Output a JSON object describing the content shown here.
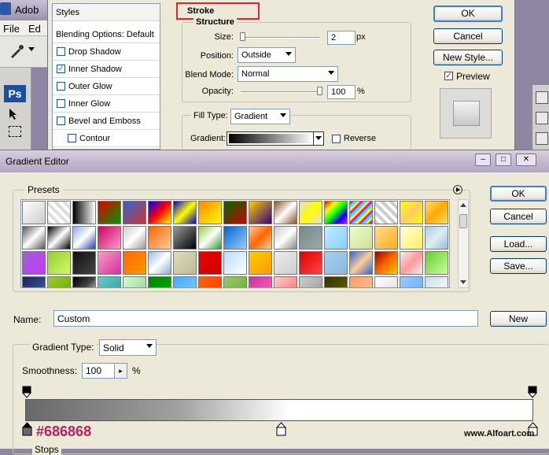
{
  "photoshop": {
    "title": "Adob",
    "menu": [
      "File",
      "Ed"
    ],
    "badge": "Ps"
  },
  "layer_style": {
    "styles_list": {
      "header": "Styles",
      "items": [
        {
          "label": "Blending Options: Default",
          "checkbox": false
        },
        {
          "label": "Drop Shadow",
          "checkbox": true,
          "checked": false
        },
        {
          "label": "Inner Shadow",
          "checkbox": true,
          "checked": true
        },
        {
          "label": "Outer Glow",
          "checkbox": true,
          "checked": false
        },
        {
          "label": "Inner Glow",
          "checkbox": true,
          "checked": false
        },
        {
          "label": "Bevel and Emboss",
          "checkbox": true,
          "checked": false
        },
        {
          "label": "Contour",
          "checkbox": true,
          "checked": false
        }
      ]
    },
    "stroke": {
      "title": "Stroke",
      "structure_label": "Structure",
      "size_label": "Size:",
      "size_value": "2",
      "size_unit": "px",
      "position_label": "Position:",
      "position_value": "Outside",
      "blend_mode_label": "Blend Mode:",
      "blend_mode_value": "Normal",
      "opacity_label": "Opacity:",
      "opacity_value": "100",
      "opacity_unit": "%",
      "fill_type_label": "Fill Type:",
      "fill_type_value": "Gradient",
      "gradient_label": "Gradient:",
      "reverse_label": "Reverse",
      "size_fraction": 0.02,
      "opacity_fraction": 1.0
    },
    "buttons": {
      "ok": "OK",
      "cancel": "Cancel",
      "new_style": "New Style...",
      "preview": "Preview"
    }
  },
  "gradient_editor": {
    "title": "Gradient Editor",
    "presets_label": "Presets",
    "name_label": "Name:",
    "name_value": "Custom",
    "new_button": "New",
    "ok_button": "OK",
    "cancel_button": "Cancel",
    "load_button": "Load...",
    "save_button": "Save...",
    "gradient_type_label": "Gradient Type:",
    "gradient_type_value": "Solid",
    "smoothness_label": "Smoothness:",
    "smoothness_value": "100",
    "smoothness_unit": "%",
    "stops_label": "Stops",
    "selected_stop_color": "#686868",
    "selected_stop_label": "#686868",
    "watermark": "www.Alfoart.com",
    "preset_swatches": [
      "linear-gradient(135deg,#fff,#ccc)",
      "repeating-linear-gradient(45deg,#ddd 0 4px,#fff 4px 8px)",
      "linear-gradient(90deg,#000,#fff)",
      "linear-gradient(135deg,#d00,#090)",
      "linear-gradient(135deg,#36c,#c33)",
      "linear-gradient(135deg,#00f,#f00,#ff0)",
      "linear-gradient(135deg,#00c,#ff0,#00c)",
      "linear-gradient(135deg,#f80,#ff0)",
      "linear-gradient(135deg,#060,#c00)",
      "linear-gradient(135deg,#fc0,#308)",
      "linear-gradient(135deg,#852,#fff,#852)",
      "linear-gradient(135deg,#ddd,#ff0,#ddd)",
      "linear-gradient(135deg,#f00,#ff0,#0f0,#00f,#f0f)",
      "repeating-linear-gradient(135deg,#f0f 0 3px,#0ff 3px 6px,#ff0 6px 9px)",
      "repeating-linear-gradient(45deg,#ccc 0 4px,#fff 4px 8px)",
      "linear-gradient(135deg,#ff0,#fc6,#ff0)",
      "linear-gradient(135deg,#fd6,#fa0,#fd6)",
      "linear-gradient(135deg,#555,#fff,#555)",
      "linear-gradient(135deg,#000,#fff,#000)",
      "linear-gradient(135deg,#8ae,#fff,#24a)",
      "linear-gradient(135deg,#c06,#f9c)",
      "linear-gradient(135deg,#ccc,#fff,#999)",
      "linear-gradient(135deg,#f60,#fc9)",
      "linear-gradient(135deg,#999,#000)",
      "linear-gradient(135deg,#9c3,#fff,#393)",
      "linear-gradient(135deg,#06c,#9cf)",
      "linear-gradient(135deg,#fc9,#f60,#fc9)",
      "linear-gradient(135deg,#ccc,#fff,#888)",
      "linear-gradient(135deg,#788,#9aa)",
      "linear-gradient(135deg,#bef,#8cf)",
      "linear-gradient(135deg,#efc,#cd9)",
      "linear-gradient(135deg,#fd8,#fa2)",
      "linear-gradient(135deg,#ffd,#fe6)",
      "linear-gradient(135deg,#ace,#dee,#9bd)",
      "linear-gradient(135deg,#96c,#c3f)",
      "linear-gradient(135deg,#9c3,#cf6)",
      "linear-gradient(135deg,#111,#444)",
      "linear-gradient(135deg,#f9c,#c39)",
      "linear-gradient(135deg,#f60,#f90)",
      "linear-gradient(135deg,#9bd,#fff,#8ac)",
      "linear-gradient(135deg,#ddb,#bb9)",
      "linear-gradient(135deg,#e00,#c00)",
      "linear-gradient(135deg,#bdf,#fff)",
      "linear-gradient(135deg,#fc0,#f90)",
      "linear-gradient(135deg,#eee,#ccc)",
      "linear-gradient(135deg,#d00,#f44)",
      "linear-gradient(135deg,#ace,#8bd)",
      "linear-gradient(135deg,#36c,#fc9,#36c)",
      "linear-gradient(135deg,#900,#f60,#fc0)",
      "linear-gradient(135deg,#eee,#f99,#eee)",
      "linear-gradient(135deg,#6c3,#cf9)",
      "linear-gradient(135deg,#225,#36a)",
      "linear-gradient(135deg,#9c3,#6a0)",
      "linear-gradient(135deg,#000,#444,#fff)",
      "linear-gradient(135deg,#6cc,#399)",
      "linear-gradient(135deg,#cfc,#9c9)",
      "linear-gradient(135deg,#080,#0a0)",
      "linear-gradient(135deg,#4af,#8cf)",
      "linear-gradient(135deg,#f60,#f30)",
      "linear-gradient(135deg,#9c6,#6a3)",
      "linear-gradient(135deg,#c39,#f6c)",
      "linear-gradient(135deg,#fcc,#f66)",
      "linear-gradient(135deg,#ccc,#999)",
      "linear-gradient(135deg,#330,#660)",
      "linear-gradient(135deg,#f96,#fc9)",
      "linear-gradient(135deg,#fff,#ddd)",
      "linear-gradient(135deg,#9cf,#6af)",
      "linear-gradient(135deg,#cde,#fff)"
    ]
  }
}
